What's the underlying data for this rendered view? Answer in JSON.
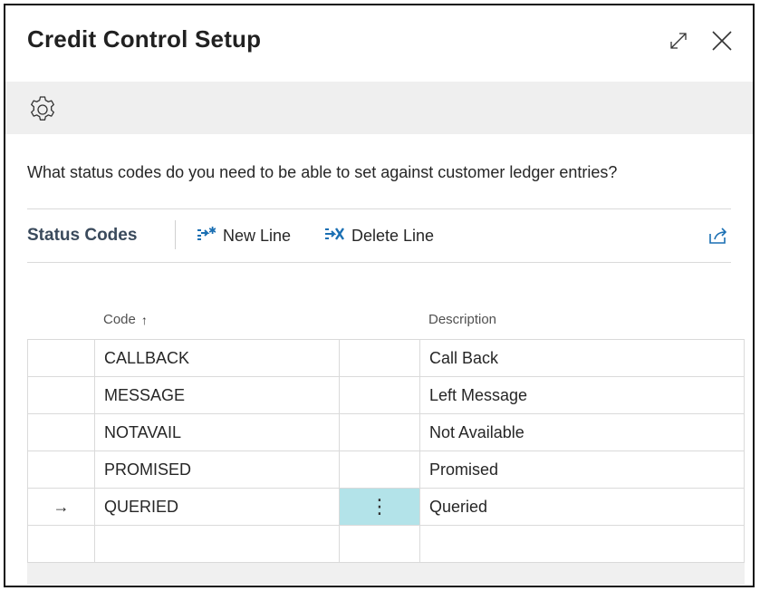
{
  "dialog": {
    "title": "Credit Control Setup",
    "question": "What status codes do you need to be able to set against customer ledger entries?"
  },
  "icons": {
    "expand": "expand-icon",
    "close": "close-icon",
    "settings": "gear-icon",
    "new_line": "new-line-icon",
    "delete_line": "delete-line-icon",
    "share": "share-icon"
  },
  "part": {
    "title": "Status Codes",
    "new_line_label": "New Line",
    "delete_line_label": "Delete Line"
  },
  "grid": {
    "columns": {
      "code": "Code",
      "description": "Description",
      "sort_indicator": "↑"
    },
    "rows": [
      {
        "marker": "",
        "code": "CALLBACK",
        "actions": "",
        "description": "Call Back"
      },
      {
        "marker": "",
        "code": "MESSAGE",
        "actions": "",
        "description": "Left Message"
      },
      {
        "marker": "",
        "code": "NOTAVAIL",
        "actions": "",
        "description": "Not Available"
      },
      {
        "marker": "",
        "code": "PROMISED",
        "actions": "",
        "description": "Promised"
      },
      {
        "marker": "→",
        "code": "QUERIED",
        "actions": "⋮",
        "description": "Queried"
      },
      {
        "marker": "",
        "code": "",
        "actions": "",
        "description": ""
      }
    ]
  },
  "colors": {
    "active_cell": "#b3e3e9",
    "action_bar": "#efefef"
  }
}
